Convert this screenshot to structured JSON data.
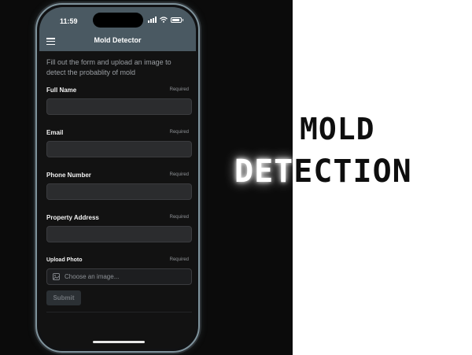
{
  "status_bar": {
    "time": "11:59"
  },
  "app": {
    "title": "Mold Detector",
    "intro": "Fill out the form and upload an image to detect the probablity of mold"
  },
  "form": {
    "required_label": "Required",
    "fields": [
      {
        "label": "Full Name",
        "value": ""
      },
      {
        "label": "Email",
        "value": ""
      },
      {
        "label": "Phone Number",
        "value": ""
      },
      {
        "label": "Property Address",
        "value": ""
      }
    ],
    "upload": {
      "label": "Upload Photo",
      "placeholder": "Choose an image..."
    },
    "submit_label": "Submit"
  },
  "banner": {
    "line1": "MOLD",
    "line2_glow": "DET",
    "line2_rest": "ECTION"
  },
  "colors": {
    "appbar": "#4a5962",
    "screen_bg": "#121212",
    "input_bg": "#2b2c2e",
    "submit_bg": "#2b3034"
  },
  "icons": [
    "menu-icon",
    "signal-icon",
    "wifi-icon",
    "battery-icon",
    "image-icon"
  ]
}
